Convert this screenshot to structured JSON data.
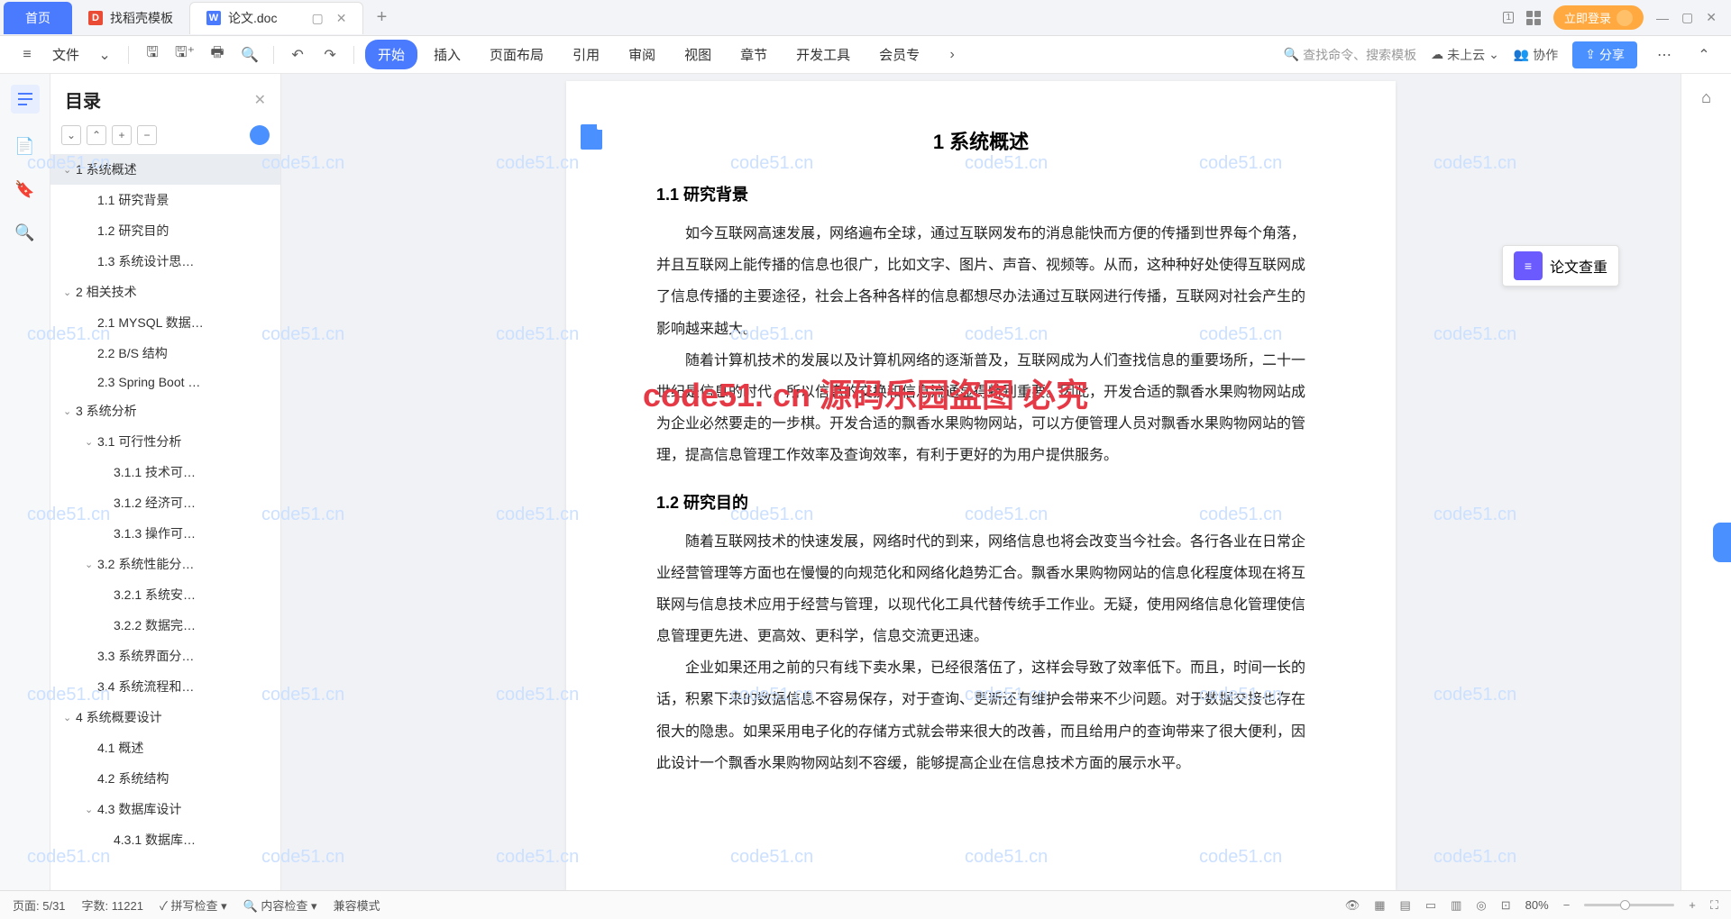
{
  "tabs": {
    "home": "首页",
    "template": "找稻壳模板",
    "doc": "论文.doc"
  },
  "tabbar": {
    "login": "立即登录"
  },
  "toolbar": {
    "file": "文件",
    "menus": [
      "开始",
      "插入",
      "页面布局",
      "引用",
      "审阅",
      "视图",
      "章节",
      "开发工具",
      "会员专"
    ],
    "search_placeholder": "查找命令、搜索模板",
    "cloud": "未上云",
    "collab": "协作",
    "share": "分享"
  },
  "sidebar": {
    "title": "目录",
    "items": [
      {
        "level": 0,
        "text": "1 系统概述",
        "expanded": true,
        "selected": true
      },
      {
        "level": 1,
        "text": "1.1 研究背景"
      },
      {
        "level": 1,
        "text": "1.2 研究目的"
      },
      {
        "level": 1,
        "text": "1.3 系统设计思…"
      },
      {
        "level": 0,
        "text": "2 相关技术",
        "expanded": true
      },
      {
        "level": 1,
        "text": "2.1 MYSQL 数据…"
      },
      {
        "level": 1,
        "text": "2.2 B/S 结构"
      },
      {
        "level": 1,
        "text": "2.3 Spring Boot …"
      },
      {
        "level": 0,
        "text": "3 系统分析",
        "expanded": true
      },
      {
        "level": 1,
        "text": "3.1 可行性分析",
        "expanded": true
      },
      {
        "level": 2,
        "text": "3.1.1 技术可…"
      },
      {
        "level": 2,
        "text": "3.1.2 经济可…"
      },
      {
        "level": 2,
        "text": "3.1.3 操作可…"
      },
      {
        "level": 1,
        "text": "3.2 系统性能分…",
        "expanded": true
      },
      {
        "level": 2,
        "text": "3.2.1 系统安…"
      },
      {
        "level": 2,
        "text": "3.2.2 数据完…"
      },
      {
        "level": 1,
        "text": "3.3 系统界面分…"
      },
      {
        "level": 1,
        "text": "3.4 系统流程和…"
      },
      {
        "level": 0,
        "text": "4 系统概要设计",
        "expanded": true
      },
      {
        "level": 1,
        "text": "4.1 概述"
      },
      {
        "level": 1,
        "text": "4.2 系统结构"
      },
      {
        "level": 1,
        "text": "4.3 数据库设计",
        "expanded": true
      },
      {
        "level": 2,
        "text": "4.3.1 数据库…"
      }
    ]
  },
  "doc": {
    "h1": "1 系统概述",
    "s11_title": "1.1  研究背景",
    "s11_p1": "如今互联网高速发展，网络遍布全球，通过互联网发布的消息能快而方便的传播到世界每个角落，并且互联网上能传播的信息也很广，比如文字、图片、声音、视频等。从而，这种种好处使得互联网成了信息传播的主要途径，社会上各种各样的信息都想尽办法通过互联网进行传播，互联网对社会产生的影响越来越大。",
    "s11_p2": "随着计算机技术的发展以及计算机网络的逐渐普及，互联网成为人们查找信息的重要场所，二十一世纪是信息的时代，所以信息的交换和信息流通显得特别重要。因此，开发合适的飘香水果购物网站成为企业必然要走的一步棋。开发合适的飘香水果购物网站，可以方便管理人员对飘香水果购物网站的管理，提高信息管理工作效率及查询效率，有利于更好的为用户提供服务。",
    "s12_title": "1.2 研究目的",
    "s12_p1": "随着互联网技术的快速发展，网络时代的到来，网络信息也将会改变当今社会。各行各业在日常企业经营管理等方面也在慢慢的向规范化和网络化趋势汇合。飘香水果购物网站的信息化程度体现在将互联网与信息技术应用于经营与管理，以现代化工具代替传统手工作业。无疑，使用网络信息化管理使信息管理更先进、更高效、更科学，信息交流更迅速。",
    "s12_p2": "企业如果还用之前的只有线下卖水果，已经很落伍了，这样会导致了效率低下。而且，时间一长的话，积累下来的数据信息不容易保存，对于查询、更新还有维护会带来不少问题。对于数据交接也存在很大的隐患。如果采用电子化的存储方式就会带来很大的改善，而且给用户的查询带来了很大便利，因此设计一个飘香水果购物网站刻不容缓，能够提高企业在信息技术方面的展示水平。"
  },
  "right_panel": {
    "plagiarism": "论文查重"
  },
  "statusbar": {
    "page": "页面: 5/31",
    "words": "字数: 11221",
    "spell": "拼写检查",
    "content": "内容检查",
    "compat": "兼容模式",
    "zoom": "80%"
  },
  "watermark": "code51.cn",
  "watermark_red": "code51. cn  源码乐园盗图 必究"
}
